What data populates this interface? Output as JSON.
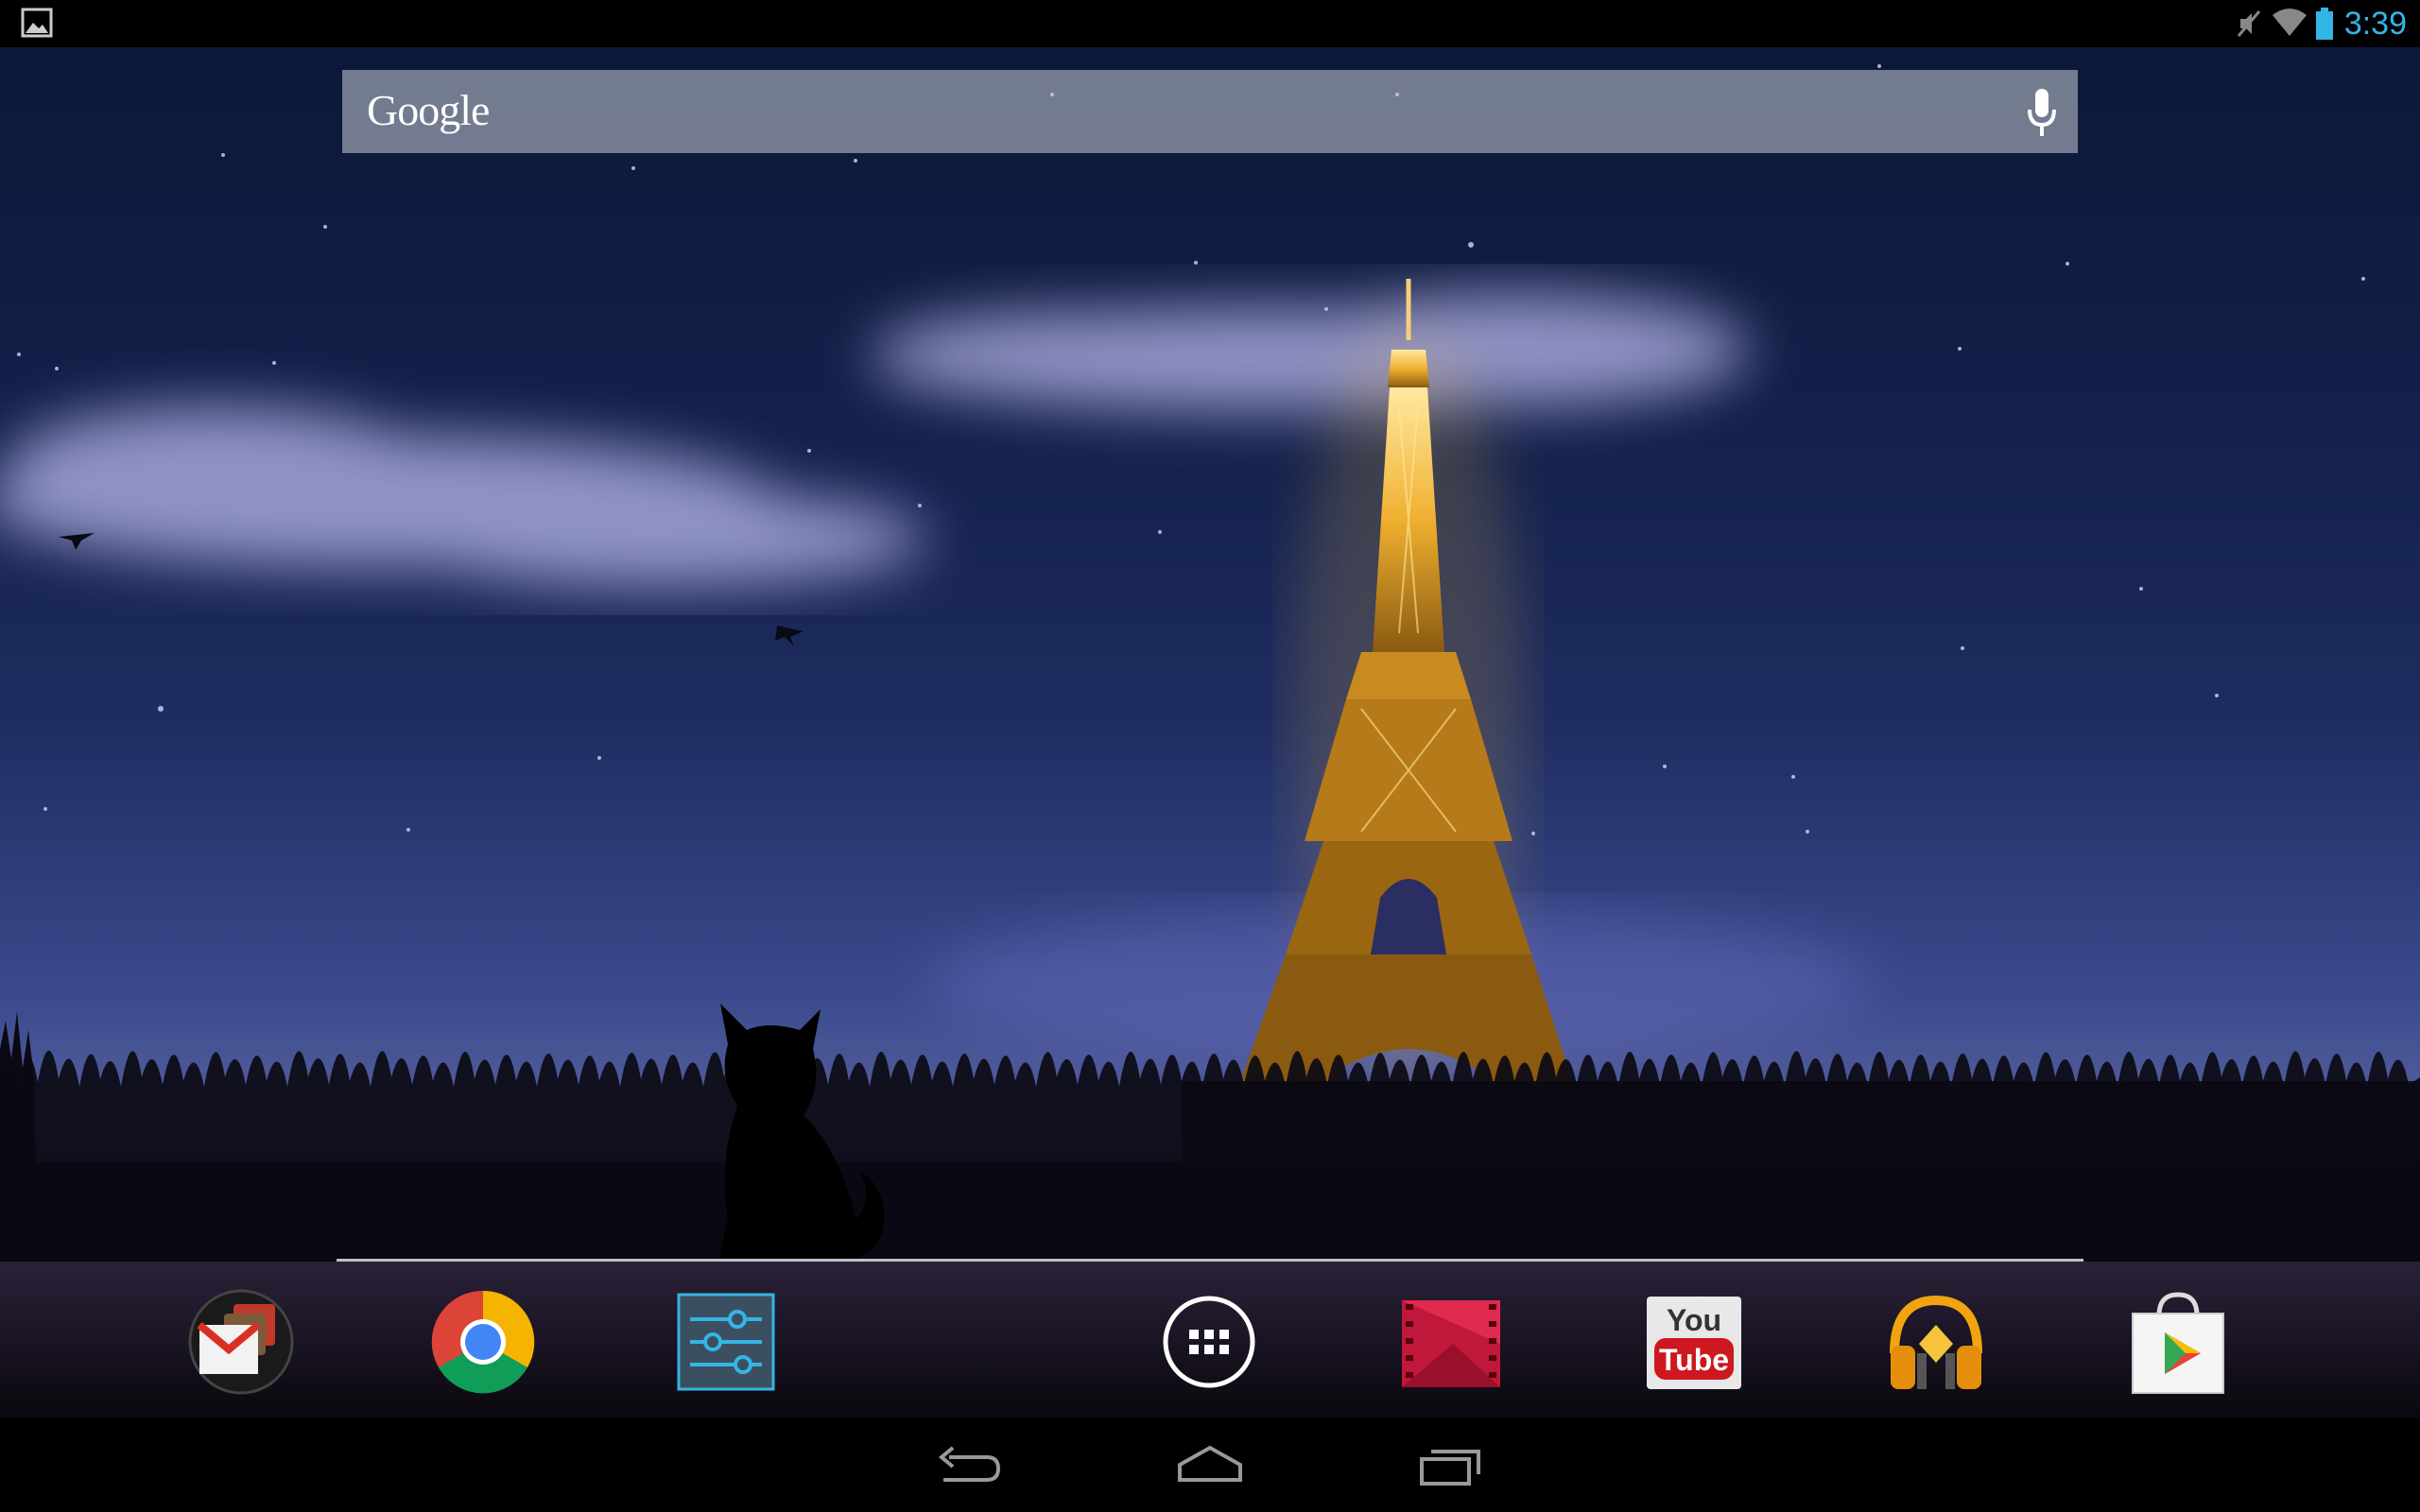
{
  "status_bar": {
    "time": "3:39",
    "notification_icon": "image-icon",
    "indicators": [
      "mute-icon",
      "wifi-icon",
      "battery-icon"
    ],
    "time_color": "#33b5e5"
  },
  "search": {
    "logo": "Google",
    "voice_icon": "mic-icon"
  },
  "dock": {
    "items": [
      {
        "name": "gmail",
        "icon": "gmail-icon"
      },
      {
        "name": "chrome",
        "icon": "chrome-icon"
      },
      {
        "name": "settings",
        "icon": "settings-icon"
      },
      {
        "name": "all-apps",
        "icon": "apps-grid-icon"
      },
      {
        "name": "play-movies",
        "icon": "movies-icon"
      },
      {
        "name": "youtube",
        "icon": "youtube-icon",
        "label_top": "You",
        "label_bottom": "Tube"
      },
      {
        "name": "play-music",
        "icon": "headphones-icon"
      },
      {
        "name": "play-store",
        "icon": "play-store-icon"
      }
    ]
  },
  "nav_bar": {
    "buttons": [
      "back-icon",
      "home-icon",
      "recents-icon"
    ]
  }
}
